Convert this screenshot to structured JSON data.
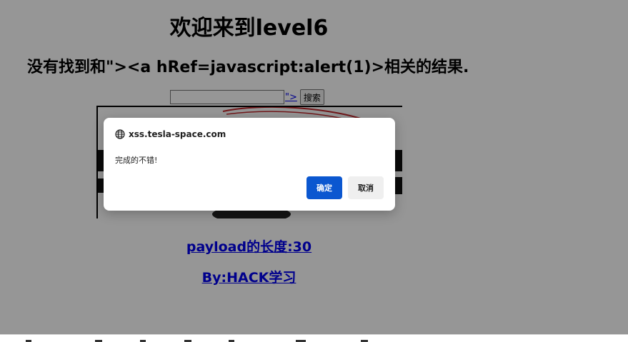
{
  "page": {
    "title": "欢迎来到level6",
    "result_text": "没有找到和\"><a hRef=javascript:alert(1)>相关的结果.",
    "search": {
      "value": "",
      "injected_link_text": "\">",
      "button_label": "搜索"
    },
    "payload_length_link": "payload的长度:30",
    "byline_link": "By:HACK学习"
  },
  "dialog": {
    "origin": "xss.tesla-space.com",
    "origin_icon": "globe-icon",
    "message": "完成的不错!",
    "ok_label": "确定",
    "cancel_label": "取消"
  },
  "colors": {
    "overlay": "#5f5f5f",
    "ok_button": "#0b57d0",
    "link": "#0000ee"
  }
}
